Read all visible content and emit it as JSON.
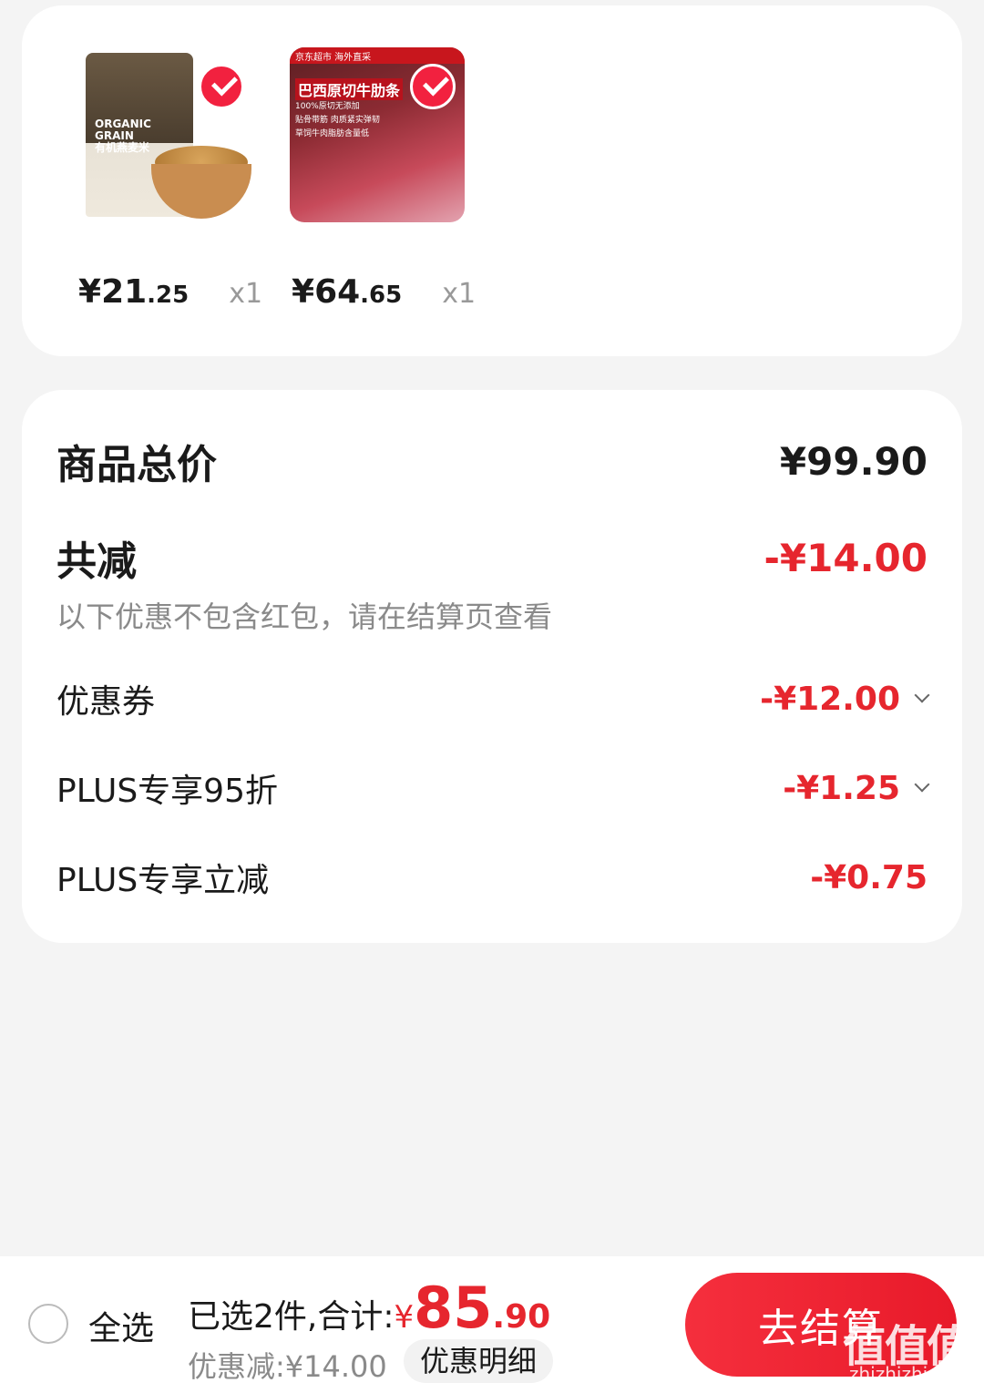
{
  "products": [
    {
      "name": "有机燕麦米",
      "image_text": [
        "ORGANIC",
        "GRAIN",
        "有机燕麦米"
      ],
      "price_yen": "¥",
      "price_int": "21",
      "price_dec": ".25",
      "qty": "x1",
      "selected": true
    },
    {
      "name": "巴西原切牛肋条",
      "image_text": [
        "京东超市 海外直采",
        "巴西原切牛肋条",
        "100%原切无添加",
        "贴骨带筋 肉质紧实弹韧",
        "草饲牛肉脂肪含量低"
      ],
      "price_yen": "¥",
      "price_int": "64",
      "price_dec": ".65",
      "qty": "x1",
      "selected": true
    }
  ],
  "summary": {
    "total_label": "商品总价",
    "total_value": "¥99.90",
    "reduce_label": "共减",
    "reduce_value": "-¥14.00",
    "note": "以下优惠不包含红包，请在结算页查看",
    "items": [
      {
        "label": "优惠券",
        "value": "-¥12.00",
        "expandable": true
      },
      {
        "label": "PLUS专享95折",
        "value": "-¥1.25",
        "expandable": true
      },
      {
        "label": "PLUS专享立减",
        "value": "-¥0.75",
        "expandable": false
      }
    ]
  },
  "bottom_bar": {
    "select_all": "全选",
    "selected_text": "已选2件,合计:",
    "total_yen": "¥",
    "total_int": "85",
    "total_dec": ".90",
    "discount_text": "优惠减:¥14.00",
    "detail_button": "优惠明细",
    "checkout_button": "去结算"
  },
  "watermark": {
    "main": "值值值",
    "sub": "zhizhizhi.com"
  },
  "colors": {
    "accent_red": "#e6262e",
    "background": "#f4f4f4"
  }
}
